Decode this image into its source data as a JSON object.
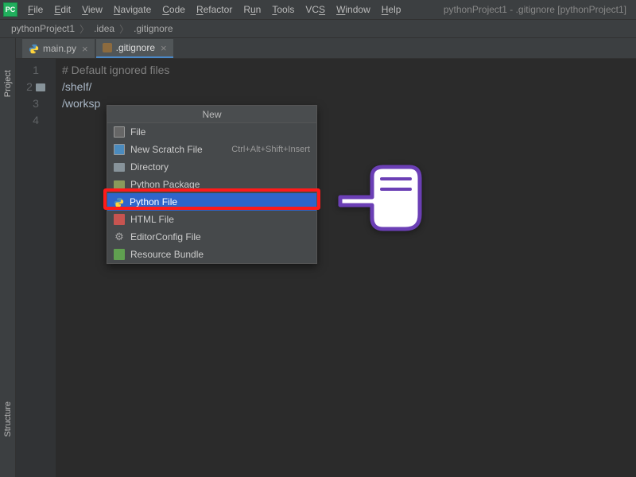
{
  "titlebar": "pythonProject1 - .gitignore [pythonProject1]",
  "menus": [
    "File",
    "Edit",
    "View",
    "Navigate",
    "Code",
    "Refactor",
    "Run",
    "Tools",
    "VCS",
    "Window",
    "Help"
  ],
  "breadcrumb": {
    "a": "pythonProject1",
    "b": ".idea",
    "c": ".gitignore"
  },
  "left_tabs": {
    "project": "Project",
    "structure": "Structure"
  },
  "tabs": {
    "main": "main.py",
    "gitignore": ".gitignore"
  },
  "gutter": [
    "1",
    "2",
    "3",
    "4"
  ],
  "code": {
    "l1": "# Default ignored files",
    "l2": "/shelf/",
    "l3": "/worksp"
  },
  "popup": {
    "title": "New",
    "items": {
      "file": "File",
      "scratch": "New Scratch File",
      "scratch_sc": "Ctrl+Alt+Shift+Insert",
      "dir": "Directory",
      "pkg": "Python Package",
      "pyfile": "Python File",
      "html": "HTML File",
      "editcfg": "EditorConfig File",
      "bundle": "Resource Bundle"
    }
  }
}
